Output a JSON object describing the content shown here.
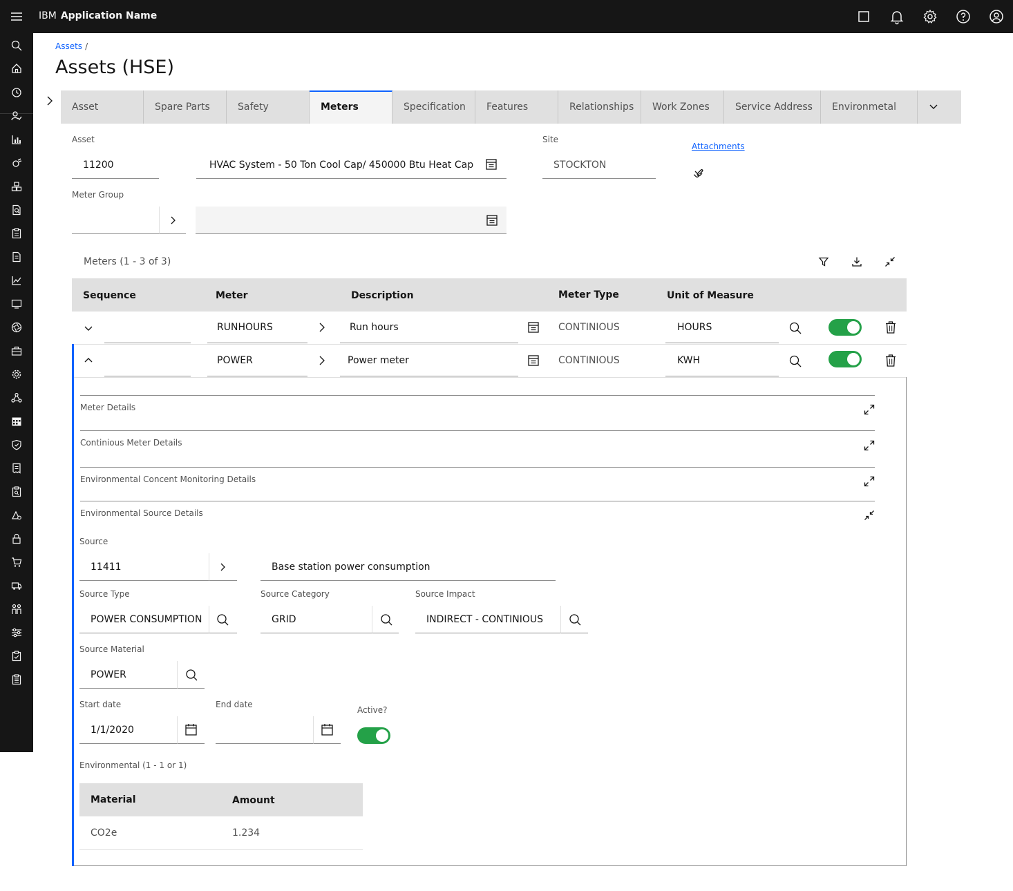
{
  "header": {
    "brand": "IBM",
    "app_name": "Application Name"
  },
  "breadcrumb": {
    "item": "Assets",
    "separator": "/"
  },
  "page_title": "Assets (HSE)",
  "tabs": [
    "Asset",
    "Spare Parts",
    "Safety",
    "Meters",
    "Specification",
    "Features",
    "Relationships",
    "Work Zones",
    "Service Address",
    "Environmetal"
  ],
  "active_tab": "Meters",
  "asset_form": {
    "asset_label": "Asset",
    "asset_value": "11200",
    "asset_description": "HVAC System - 50 Ton Cool Cap/ 450000 Btu Heat Cap",
    "site_label": "Site",
    "site_value": "STOCKTON",
    "attachments_label": "Attachments",
    "meter_group_label": "Meter Group",
    "meter_group_value": "",
    "meter_group_description": ""
  },
  "meters_table": {
    "title": "Meters (1 - 3 of 3)",
    "columns": [
      "Sequence",
      "Meter",
      "Description",
      "Meter Type",
      "Unit of Measure"
    ],
    "rows": [
      {
        "sequence": "",
        "meter": "RUNHOURS",
        "description": "Run hours",
        "meter_type": "CONTINIOUS",
        "unit": "HOURS",
        "active": true,
        "expanded": false
      },
      {
        "sequence": "",
        "meter": "POWER",
        "description": "Power meter",
        "meter_type": "CONTINIOUS",
        "unit": "KWH",
        "active": true,
        "expanded": true
      }
    ]
  },
  "details": {
    "sections": [
      "Meter Details",
      "Continious Meter Details",
      "Environmental Concent Monitoring Details",
      "Environmental Source Details"
    ],
    "source_label": "Source",
    "source_value": "11411",
    "source_description": "Base station power consumption",
    "source_type_label": "Source Type",
    "source_type_value": "POWER CONSUMPTION",
    "source_category_label": "Source Category",
    "source_category_value": "GRID",
    "source_impact_label": "Source Impact",
    "source_impact_value": "INDIRECT - CONTINIOUS",
    "source_material_label": "Source Material",
    "source_material_value": "POWER",
    "start_date_label": "Start date",
    "start_date_value": "1/1/2020",
    "end_date_label": "End date",
    "end_date_value": "",
    "active_label": "Active?",
    "active_value": true
  },
  "environmental": {
    "title": "Environmental (1 - 1 or 1)",
    "columns": [
      "Material",
      "Amount"
    ],
    "rows": [
      {
        "material": "CO2e",
        "amount": "1.234"
      }
    ]
  },
  "colors": {
    "header_bg": "#161616",
    "accent": "#0f62fe",
    "toggle_on": "#24a148",
    "tab_bg": "#e0e0e0"
  }
}
